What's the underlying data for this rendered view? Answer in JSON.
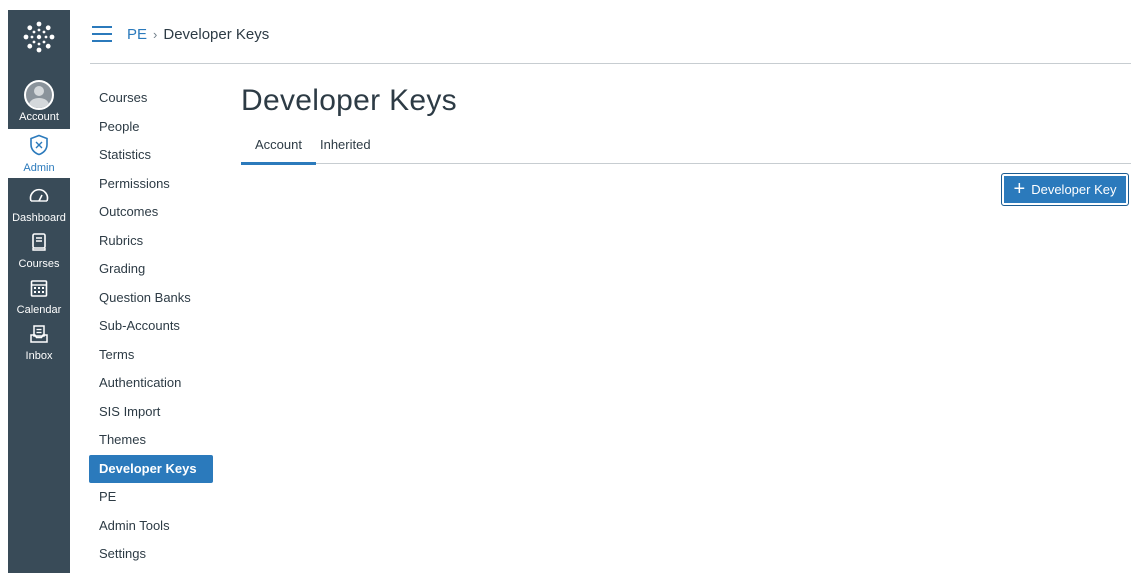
{
  "global_nav": {
    "items": [
      {
        "label": "Account"
      },
      {
        "label": "Admin"
      },
      {
        "label": "Dashboard"
      },
      {
        "label": "Courses"
      },
      {
        "label": "Calendar"
      },
      {
        "label": "Inbox"
      }
    ]
  },
  "breadcrumb": {
    "items": [
      {
        "label": "PE"
      },
      {
        "label": "Developer Keys"
      }
    ],
    "separator": "›"
  },
  "subnav": {
    "items": [
      {
        "label": "Courses"
      },
      {
        "label": "People"
      },
      {
        "label": "Statistics"
      },
      {
        "label": "Permissions"
      },
      {
        "label": "Outcomes"
      },
      {
        "label": "Rubrics"
      },
      {
        "label": "Grading"
      },
      {
        "label": "Question Banks"
      },
      {
        "label": "Sub-Accounts"
      },
      {
        "label": "Terms"
      },
      {
        "label": "Authentication"
      },
      {
        "label": "SIS Import"
      },
      {
        "label": "Themes"
      },
      {
        "label": "Developer Keys",
        "active": true
      },
      {
        "label": "PE"
      },
      {
        "label": "Admin Tools"
      },
      {
        "label": "Settings"
      }
    ]
  },
  "main": {
    "title": "Developer Keys",
    "tabs": [
      {
        "label": "Account",
        "active": true
      },
      {
        "label": "Inherited",
        "active": false
      }
    ],
    "add_button_label": "Developer Key",
    "add_button_icon": "plus-icon"
  },
  "colors": {
    "nav_bg": "#394b58",
    "accent": "#2b7abc",
    "text": "#2d3b45"
  }
}
